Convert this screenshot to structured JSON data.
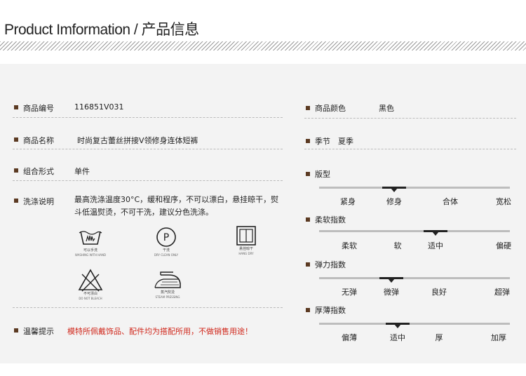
{
  "header": {
    "title": "Product Imformation / 产品信息"
  },
  "left": [
    {
      "label": "商品编号",
      "value": "116851V031"
    },
    {
      "label": "商品名称",
      "value": "时尚复古蕾丝拼接V领修身连体短裤"
    },
    {
      "label": "组合形式",
      "value": "单件"
    },
    {
      "label": "洗涤说明",
      "value": "最高洗涤温度30°C，缓和程序，不可以漂白，悬挂晾干，熨斗低温熨烫，不可干洗，建议分色洗涤。"
    },
    {
      "label": "温馨提示",
      "value": "模特所佩戴饰品、配件均为搭配所用，不做销售用途！"
    }
  ],
  "care": [
    {
      "icon": "hand-wash-icon",
      "cn": "可以手洗",
      "en": "WASHING WITH HAND"
    },
    {
      "icon": "dry-clean-icon",
      "cn": "干洗",
      "en": "DRY CLEAN ONLY",
      "glyph": "P"
    },
    {
      "icon": "hang-dry-icon",
      "cn": "悬挂晾干",
      "en": "HANG DRY"
    },
    {
      "icon": "no-bleach-icon",
      "cn": "不可漂白",
      "en": "DO NOT BLEACH"
    },
    {
      "icon": "steam-iron-icon",
      "cn": "蒸汽熨烫",
      "en": "STEAM PRESSING"
    }
  ],
  "right": {
    "color": {
      "label": "商品颜色",
      "value": "黑色"
    },
    "season": {
      "label": "季节",
      "value": "夏季"
    }
  },
  "scales": [
    {
      "label": "版型",
      "options": [
        "紧身",
        "修身",
        "合体",
        "宽松"
      ],
      "selected": 1
    },
    {
      "label": "柔软指数",
      "options": [
        "柔软",
        "软",
        "适中",
        "偏硬"
      ],
      "selected": 2
    },
    {
      "label": "弹力指数",
      "options": [
        "无弹",
        "微弹",
        "良好",
        "超弹"
      ],
      "selected": 1
    },
    {
      "label": "厚薄指数",
      "options": [
        "偏薄",
        "适中",
        "厚",
        "加厚"
      ],
      "selected": 1
    }
  ],
  "colors": {
    "bullet": "#5b3a22",
    "warning": "#d0271b",
    "panel": "#f3f3f3"
  }
}
